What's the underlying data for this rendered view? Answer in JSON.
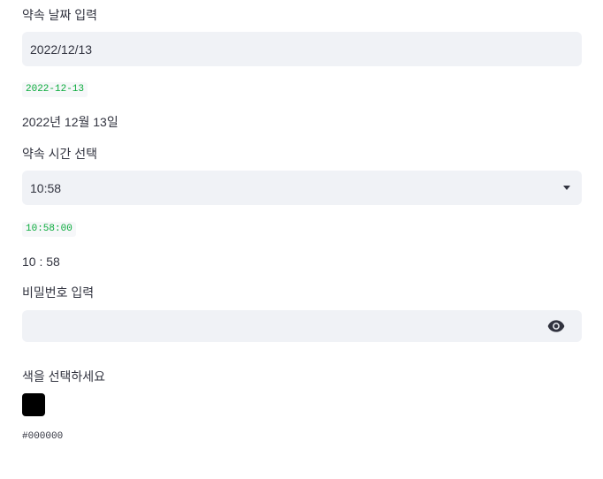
{
  "date_input": {
    "label": "약속 날짜 입력",
    "value": "2022/12/13"
  },
  "date_code": "2022-12-13",
  "date_text": "2022년 12월 13일",
  "time_input": {
    "label": "약속 시간 선택",
    "value": "10:58",
    "icon": "chevron-down-icon"
  },
  "time_code": "10:58:00",
  "time_text": "10 : 58",
  "password_input": {
    "label": "비밀번호 입력",
    "value": "",
    "icon": "eye-icon"
  },
  "color_picker": {
    "label": "색을 선택하세요",
    "value": "#000000",
    "swatch_color": "#000000"
  },
  "color_code": "#000000",
  "colors": {
    "field_background": "#f0f2f6",
    "text": "#31333f",
    "code_green": "#09ab3b"
  }
}
